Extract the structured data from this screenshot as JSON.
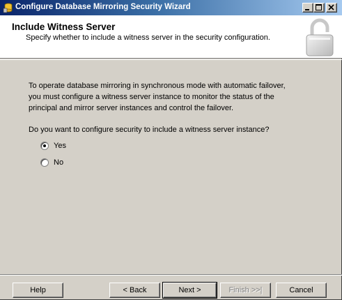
{
  "window": {
    "title": "Configure Database Mirroring Security Wizard",
    "icon": "database-wizard-icon"
  },
  "titlebar_buttons": {
    "minimize": "minimize-icon",
    "maximize": "maximize-icon",
    "close": "close-icon"
  },
  "header": {
    "title": "Include Witness Server",
    "subtitle": "Specify whether to include a witness server in the security configuration.",
    "icon": "padlock-icon"
  },
  "main": {
    "intro": "To operate database mirroring in synchronous mode with automatic failover, you must configure a witness server instance to monitor the status of the principal and mirror server instances and control the failover.",
    "question": "Do you want to configure security to include a witness server instance?",
    "options": [
      {
        "label": "Yes",
        "selected": true
      },
      {
        "label": "No",
        "selected": false
      }
    ]
  },
  "footer": {
    "help": "Help",
    "back": "< Back",
    "next": "Next >",
    "finish": "Finish >>|",
    "cancel": "Cancel"
  }
}
